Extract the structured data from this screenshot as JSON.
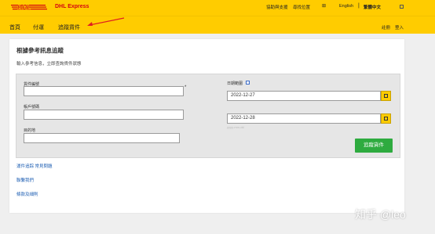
{
  "header": {
    "brand": "DHL Express",
    "utility_links": [
      "協助與支援",
      "尋找位置"
    ],
    "lang_english": "English",
    "lang_separator": "|",
    "lang_chinese": "繁體中文"
  },
  "nav": {
    "items": [
      "首頁",
      "付運",
      "追蹤貨件"
    ],
    "right_items": [
      "註冊",
      "登入"
    ]
  },
  "page": {
    "title": "根據參考訊息追蹤",
    "subtitle": "輸入參考信息，立即查詢貨件狀態"
  },
  "form": {
    "reference_label": "貨件編號",
    "reference_required": "*",
    "reference_value": "",
    "account_label": "帳戶號碼",
    "account_value": "",
    "destination_label": "目的地",
    "destination_value": "",
    "date_range_label": "日期範圍",
    "date_from": "2022-12-27",
    "date_to": "2022-12-28",
    "date_hint": "yyyy-mm-dd",
    "submit_label": "追蹤貨件"
  },
  "links": [
    "運件追踪 常見問題",
    "聯繫我們",
    "條款及細則"
  ],
  "watermark": "知乎 @leo",
  "colors": {
    "dhl_yellow": "#ffcc00",
    "dhl_red": "#d40511",
    "button_green": "#2eab3f",
    "link_blue": "#1e5fb3"
  }
}
